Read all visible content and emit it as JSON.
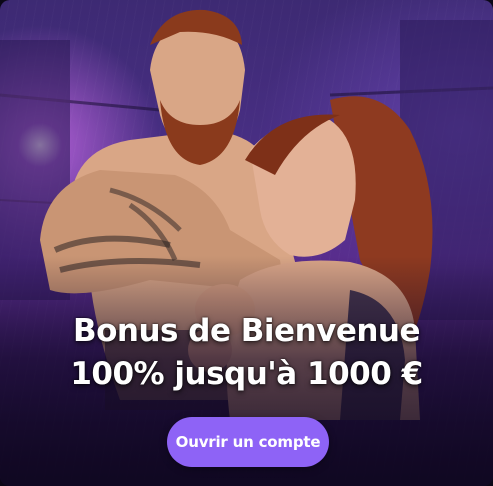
{
  "banner": {
    "title_line1": "Bonus de Bienvenue",
    "title_line2": "100% jusqu'à 1000 €",
    "cta_label": "Ouvrir un compte",
    "accent_color": "#8e63f6"
  }
}
